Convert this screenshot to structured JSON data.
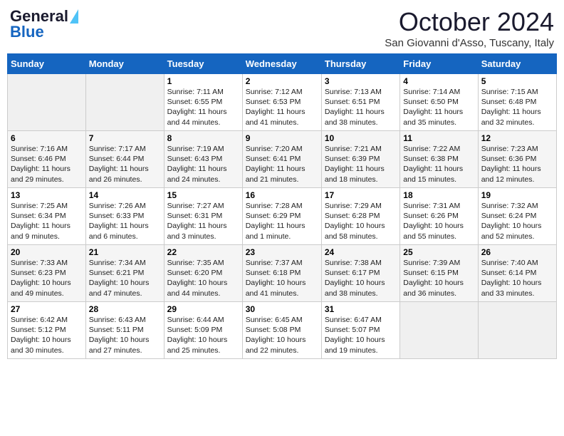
{
  "header": {
    "logo_general": "General",
    "logo_blue": "Blue",
    "month_title": "October 2024",
    "location": "San Giovanni d'Asso, Tuscany, Italy"
  },
  "days_of_week": [
    "Sunday",
    "Monday",
    "Tuesday",
    "Wednesday",
    "Thursday",
    "Friday",
    "Saturday"
  ],
  "weeks": [
    [
      {
        "day": "",
        "sunrise": "",
        "sunset": "",
        "daylight": ""
      },
      {
        "day": "",
        "sunrise": "",
        "sunset": "",
        "daylight": ""
      },
      {
        "day": "1",
        "sunrise": "Sunrise: 7:11 AM",
        "sunset": "Sunset: 6:55 PM",
        "daylight": "Daylight: 11 hours and 44 minutes."
      },
      {
        "day": "2",
        "sunrise": "Sunrise: 7:12 AM",
        "sunset": "Sunset: 6:53 PM",
        "daylight": "Daylight: 11 hours and 41 minutes."
      },
      {
        "day": "3",
        "sunrise": "Sunrise: 7:13 AM",
        "sunset": "Sunset: 6:51 PM",
        "daylight": "Daylight: 11 hours and 38 minutes."
      },
      {
        "day": "4",
        "sunrise": "Sunrise: 7:14 AM",
        "sunset": "Sunset: 6:50 PM",
        "daylight": "Daylight: 11 hours and 35 minutes."
      },
      {
        "day": "5",
        "sunrise": "Sunrise: 7:15 AM",
        "sunset": "Sunset: 6:48 PM",
        "daylight": "Daylight: 11 hours and 32 minutes."
      }
    ],
    [
      {
        "day": "6",
        "sunrise": "Sunrise: 7:16 AM",
        "sunset": "Sunset: 6:46 PM",
        "daylight": "Daylight: 11 hours and 29 minutes."
      },
      {
        "day": "7",
        "sunrise": "Sunrise: 7:17 AM",
        "sunset": "Sunset: 6:44 PM",
        "daylight": "Daylight: 11 hours and 26 minutes."
      },
      {
        "day": "8",
        "sunrise": "Sunrise: 7:19 AM",
        "sunset": "Sunset: 6:43 PM",
        "daylight": "Daylight: 11 hours and 24 minutes."
      },
      {
        "day": "9",
        "sunrise": "Sunrise: 7:20 AM",
        "sunset": "Sunset: 6:41 PM",
        "daylight": "Daylight: 11 hours and 21 minutes."
      },
      {
        "day": "10",
        "sunrise": "Sunrise: 7:21 AM",
        "sunset": "Sunset: 6:39 PM",
        "daylight": "Daylight: 11 hours and 18 minutes."
      },
      {
        "day": "11",
        "sunrise": "Sunrise: 7:22 AM",
        "sunset": "Sunset: 6:38 PM",
        "daylight": "Daylight: 11 hours and 15 minutes."
      },
      {
        "day": "12",
        "sunrise": "Sunrise: 7:23 AM",
        "sunset": "Sunset: 6:36 PM",
        "daylight": "Daylight: 11 hours and 12 minutes."
      }
    ],
    [
      {
        "day": "13",
        "sunrise": "Sunrise: 7:25 AM",
        "sunset": "Sunset: 6:34 PM",
        "daylight": "Daylight: 11 hours and 9 minutes."
      },
      {
        "day": "14",
        "sunrise": "Sunrise: 7:26 AM",
        "sunset": "Sunset: 6:33 PM",
        "daylight": "Daylight: 11 hours and 6 minutes."
      },
      {
        "day": "15",
        "sunrise": "Sunrise: 7:27 AM",
        "sunset": "Sunset: 6:31 PM",
        "daylight": "Daylight: 11 hours and 3 minutes."
      },
      {
        "day": "16",
        "sunrise": "Sunrise: 7:28 AM",
        "sunset": "Sunset: 6:29 PM",
        "daylight": "Daylight: 11 hours and 1 minute."
      },
      {
        "day": "17",
        "sunrise": "Sunrise: 7:29 AM",
        "sunset": "Sunset: 6:28 PM",
        "daylight": "Daylight: 10 hours and 58 minutes."
      },
      {
        "day": "18",
        "sunrise": "Sunrise: 7:31 AM",
        "sunset": "Sunset: 6:26 PM",
        "daylight": "Daylight: 10 hours and 55 minutes."
      },
      {
        "day": "19",
        "sunrise": "Sunrise: 7:32 AM",
        "sunset": "Sunset: 6:24 PM",
        "daylight": "Daylight: 10 hours and 52 minutes."
      }
    ],
    [
      {
        "day": "20",
        "sunrise": "Sunrise: 7:33 AM",
        "sunset": "Sunset: 6:23 PM",
        "daylight": "Daylight: 10 hours and 49 minutes."
      },
      {
        "day": "21",
        "sunrise": "Sunrise: 7:34 AM",
        "sunset": "Sunset: 6:21 PM",
        "daylight": "Daylight: 10 hours and 47 minutes."
      },
      {
        "day": "22",
        "sunrise": "Sunrise: 7:35 AM",
        "sunset": "Sunset: 6:20 PM",
        "daylight": "Daylight: 10 hours and 44 minutes."
      },
      {
        "day": "23",
        "sunrise": "Sunrise: 7:37 AM",
        "sunset": "Sunset: 6:18 PM",
        "daylight": "Daylight: 10 hours and 41 minutes."
      },
      {
        "day": "24",
        "sunrise": "Sunrise: 7:38 AM",
        "sunset": "Sunset: 6:17 PM",
        "daylight": "Daylight: 10 hours and 38 minutes."
      },
      {
        "day": "25",
        "sunrise": "Sunrise: 7:39 AM",
        "sunset": "Sunset: 6:15 PM",
        "daylight": "Daylight: 10 hours and 36 minutes."
      },
      {
        "day": "26",
        "sunrise": "Sunrise: 7:40 AM",
        "sunset": "Sunset: 6:14 PM",
        "daylight": "Daylight: 10 hours and 33 minutes."
      }
    ],
    [
      {
        "day": "27",
        "sunrise": "Sunrise: 6:42 AM",
        "sunset": "Sunset: 5:12 PM",
        "daylight": "Daylight: 10 hours and 30 minutes."
      },
      {
        "day": "28",
        "sunrise": "Sunrise: 6:43 AM",
        "sunset": "Sunset: 5:11 PM",
        "daylight": "Daylight: 10 hours and 27 minutes."
      },
      {
        "day": "29",
        "sunrise": "Sunrise: 6:44 AM",
        "sunset": "Sunset: 5:09 PM",
        "daylight": "Daylight: 10 hours and 25 minutes."
      },
      {
        "day": "30",
        "sunrise": "Sunrise: 6:45 AM",
        "sunset": "Sunset: 5:08 PM",
        "daylight": "Daylight: 10 hours and 22 minutes."
      },
      {
        "day": "31",
        "sunrise": "Sunrise: 6:47 AM",
        "sunset": "Sunset: 5:07 PM",
        "daylight": "Daylight: 10 hours and 19 minutes."
      },
      {
        "day": "",
        "sunrise": "",
        "sunset": "",
        "daylight": ""
      },
      {
        "day": "",
        "sunrise": "",
        "sunset": "",
        "daylight": ""
      }
    ]
  ]
}
